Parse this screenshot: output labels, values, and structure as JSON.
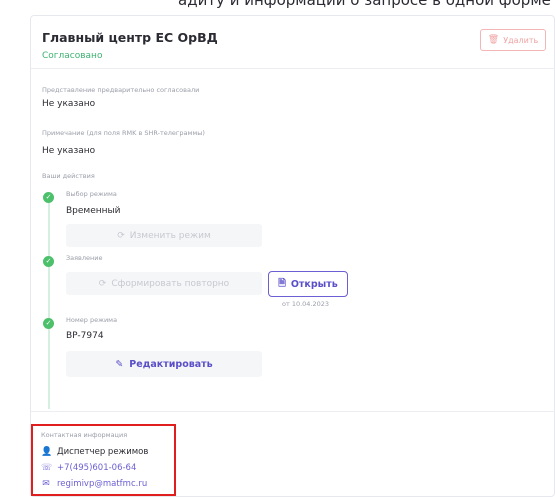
{
  "page": {
    "top_clip_text": "адиту и информации о запросе в одной форме"
  },
  "header": {
    "title": "Главный центр ЕС ОрВД",
    "status": "Согласовано",
    "delete_label": "Удалить",
    "delete_icon": "trash-icon"
  },
  "fields": {
    "presentation_label": "Представление предварительно согласовали",
    "presentation_value": "Не указано",
    "note_label": "Примечание (для поля RMK в SHR-телеграммы)",
    "note_value": "Не указано"
  },
  "actions": {
    "section_label": "Ваши действия",
    "steps": [
      {
        "label": "Выбор режима",
        "value": "Временный",
        "button_label": "Изменить режим",
        "button_icon": "refresh-icon"
      },
      {
        "label": "Заявление",
        "button_label": "Сформировать повторно",
        "button_icon": "refresh-icon",
        "open_label": "Открыть",
        "open_icon": "document-icon",
        "date_note": "от 10.04.2023"
      },
      {
        "label": "Номер режима",
        "value": "BP-7974",
        "button_label": "Редактировать",
        "button_icon": "pencil-icon"
      }
    ]
  },
  "contacts": {
    "title": "Контактная информация",
    "person": "Диспетчер режимов",
    "phone": "+7(495)601-06-64",
    "email": "regimivp@matfmc.ru"
  },
  "colors": {
    "accent": "#5a4fc8",
    "success": "#4cc06b",
    "danger": "#e01e1e"
  }
}
